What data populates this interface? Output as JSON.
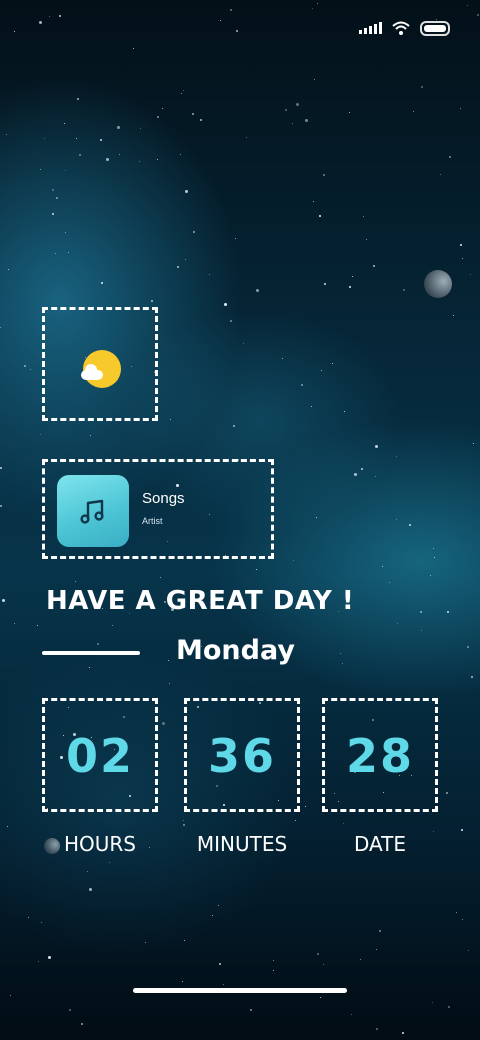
{
  "status_bar": {
    "signal_icon": "signal-icon",
    "wifi_icon": "wifi-icon",
    "battery_icon": "battery-icon"
  },
  "weather_widget": {
    "icon": "partly-sunny-icon",
    "sun_color": "#f7c92a"
  },
  "music_widget": {
    "album_icon": "music-note-icon",
    "title": "Songs",
    "artist": "Artist",
    "album_color": "#4ec6d6"
  },
  "greeting": "HAVE A GREAT DAY !",
  "weekday": "Monday",
  "time": {
    "hours_value": "02",
    "hours_label": "HOURS",
    "minutes_value": "36",
    "minutes_label": "MINUTES",
    "date_value": "28",
    "date_label": "DATE",
    "number_color": "#5fd8e8"
  },
  "home_indicator": "home-indicator"
}
